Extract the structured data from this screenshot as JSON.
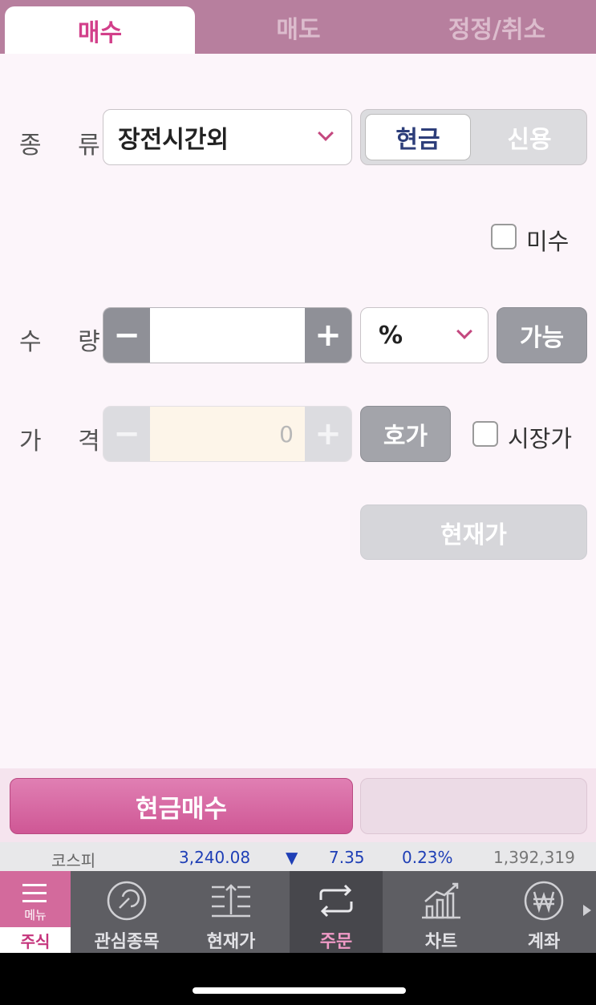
{
  "tabs": [
    {
      "label": "매수",
      "active": true
    },
    {
      "label": "매도",
      "active": false
    },
    {
      "label": "정정/취소",
      "active": false
    }
  ],
  "form": {
    "type_label": "종 류",
    "type_value": "장전시간외",
    "cash_label": "현금",
    "credit_label": "신용",
    "misu_label": "미수",
    "qty_label": "수 량",
    "qty_value": "",
    "qty_unit": "%",
    "available_label": "가능",
    "price_label": "가 격",
    "price_value": "0",
    "quote_label": "호가",
    "market_price_label": "시장가",
    "current_price_label": "현재가"
  },
  "action": {
    "buy_label": "현금매수"
  },
  "ticker": {
    "name": "코스피",
    "value": "3,240.08",
    "direction": "▼",
    "change": "7.35",
    "rate": "0.23%",
    "volume": "1,392,319"
  },
  "nav": {
    "menu_label": "메뉴",
    "section_label": "주식",
    "items": [
      {
        "label": "관심종목",
        "icon": "watchlist-icon"
      },
      {
        "label": "현재가",
        "icon": "current-price-icon"
      },
      {
        "label": "주문",
        "icon": "order-icon",
        "active": true
      },
      {
        "label": "차트",
        "icon": "chart-icon"
      },
      {
        "label": "계좌",
        "icon": "account-icon"
      }
    ]
  },
  "colors": {
    "accent": "#d23f8a",
    "tab_bg": "#b77f9e",
    "nav_bg": "#5e5e63",
    "ticker_up_down": "#1f3fb6"
  }
}
